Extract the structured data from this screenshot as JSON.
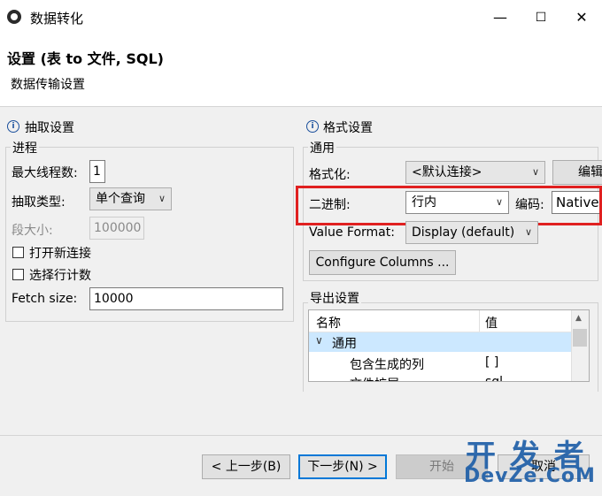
{
  "window": {
    "title": "数据转化",
    "minimize_glyph": "—",
    "maximize_glyph": "☐",
    "close_glyph": "✕"
  },
  "header": {
    "title": "设置 (表 to 文件, SQL)",
    "subtitle": "数据传输设置"
  },
  "left": {
    "section_title": "抽取设置",
    "group_title": "进程",
    "max_threads_label": "最大线程数:",
    "max_threads_value": "1",
    "extract_type_label": "抽取类型:",
    "extract_type_value": "单个查询",
    "segment_size_label": "段大小:",
    "segment_size_value": "100000",
    "open_new_conn_label": "打开新连接",
    "select_row_count_label": "选择行计数",
    "fetch_size_label": "Fetch size:",
    "fetch_size_value": "10000"
  },
  "right": {
    "section_title": "格式设置",
    "group_title": "通用",
    "formatting_label": "格式化:",
    "formatting_value": "<默认连接>",
    "edit_button_label": "编辑",
    "binary_label": "二进制:",
    "binary_value": "行内",
    "encoding_label": "编码:",
    "encoding_value": "Native",
    "value_format_label": "Value Format:",
    "value_format_value": "Display (default)",
    "configure_columns_label": "Configure Columns ...",
    "export_group_title": "导出设置",
    "tree_headers": {
      "name": "名称",
      "value": "值"
    },
    "tree_rows": [
      {
        "name": "通用",
        "value": "",
        "expand": "∨"
      },
      {
        "name": "包含生成的列",
        "value": "[ ]"
      },
      {
        "name": "文件扩展",
        "value": "sql"
      }
    ]
  },
  "footer": {
    "back_label": "< 上一步(B)",
    "next_label": "下一步(N) >",
    "start_label": "开始",
    "cancel_label": "取消"
  },
  "watermark": {
    "line1": "开 发 者",
    "line2": "DevZe.CoM"
  },
  "colors": {
    "highlight_box": "#e02020",
    "focus_border": "#0078d7",
    "watermark": "#1f5fa8"
  }
}
